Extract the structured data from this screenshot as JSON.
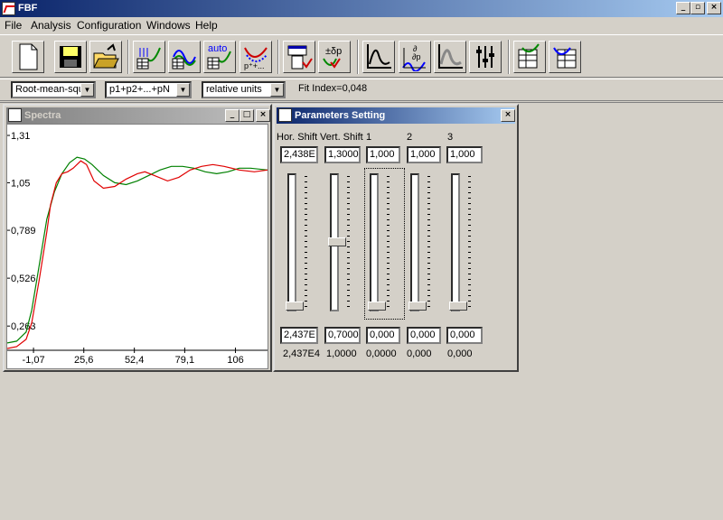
{
  "app": {
    "title": "FBF"
  },
  "menu": [
    "File",
    "Analysis",
    "Configuration",
    "Windows",
    "Help"
  ],
  "toolbar": {
    "icons": [
      "new-document-icon",
      "save-icon",
      "open-folder-icon",
      "table-fit-icon",
      "fit-curve-icon",
      "auto-fit-icon",
      "peak-params-icon",
      "select-sheet-icon",
      "sign-shift-icon",
      "spectrum-icon",
      "derivative-icon",
      "smooth-spectrum-icon",
      "sliders-icon",
      "export-table-icon",
      "import-table-icon"
    ],
    "auto_text": "auto",
    "spd_text": "±δp"
  },
  "options": {
    "metric": "Root-mean-squ",
    "model": "p1+p2+...+pN",
    "units": "relative units",
    "fit_index": "Fit Index=0,048"
  },
  "spectra": {
    "title": "Spectra",
    "chart_data": {
      "type": "line",
      "y_ticks": [
        "1,31",
        "1,05",
        "0,789",
        "0,526",
        "0,263"
      ],
      "x_ticks": [
        "-1,07",
        "25,6",
        "52,4",
        "79,1",
        "106"
      ],
      "xlim": [
        -15,
        123
      ],
      "ylim": [
        0.13,
        1.31
      ],
      "series": [
        {
          "color": "#008000",
          "points": [
            [
              -15,
              0.17
            ],
            [
              -10,
              0.18
            ],
            [
              -5,
              0.23
            ],
            [
              -2,
              0.35
            ],
            [
              2,
              0.6
            ],
            [
              6,
              0.85
            ],
            [
              10,
              1.0
            ],
            [
              14,
              1.1
            ],
            [
              18,
              1.16
            ],
            [
              22,
              1.19
            ],
            [
              26,
              1.18
            ],
            [
              30,
              1.15
            ],
            [
              36,
              1.09
            ],
            [
              42,
              1.05
            ],
            [
              48,
              1.04
            ],
            [
              54,
              1.06
            ],
            [
              60,
              1.09
            ],
            [
              66,
              1.12
            ],
            [
              72,
              1.14
            ],
            [
              78,
              1.14
            ],
            [
              84,
              1.13
            ],
            [
              90,
              1.11
            ],
            [
              96,
              1.1
            ],
            [
              102,
              1.11
            ],
            [
              108,
              1.13
            ],
            [
              114,
              1.13
            ],
            [
              123,
              1.12
            ]
          ]
        },
        {
          "color": "#e00000",
          "points": [
            [
              -15,
              0.14
            ],
            [
              -10,
              0.15
            ],
            [
              -5,
              0.19
            ],
            [
              -2,
              0.28
            ],
            [
              2,
              0.52
            ],
            [
              6,
              0.78
            ],
            [
              8,
              0.93
            ],
            [
              11,
              1.05
            ],
            [
              14,
              1.1
            ],
            [
              17,
              1.11
            ],
            [
              20,
              1.13
            ],
            [
              24,
              1.17
            ],
            [
              27,
              1.15
            ],
            [
              31,
              1.06
            ],
            [
              36,
              1.02
            ],
            [
              42,
              1.03
            ],
            [
              48,
              1.07
            ],
            [
              54,
              1.1
            ],
            [
              58,
              1.11
            ],
            [
              63,
              1.09
            ],
            [
              70,
              1.06
            ],
            [
              76,
              1.08
            ],
            [
              82,
              1.12
            ],
            [
              88,
              1.14
            ],
            [
              94,
              1.15
            ],
            [
              100,
              1.14
            ],
            [
              108,
              1.12
            ],
            [
              116,
              1.11
            ],
            [
              123,
              1.12
            ]
          ]
        }
      ]
    }
  },
  "params": {
    "title": "Parameters Setting",
    "headers": [
      "Hor. Shift",
      "Vert. Shift",
      "1",
      "2",
      "3"
    ],
    "top_values": [
      "2,438E",
      "1,3000",
      "1,000",
      "1,000",
      "1,000"
    ],
    "bottom_values": [
      "2,437E",
      "0,7000",
      "0,000",
      "0,000",
      "0,000"
    ],
    "current_values": [
      "2,437E4",
      "1,0000",
      "0,0000",
      "0,000",
      "0,000"
    ],
    "slider_levels": [
      0.0,
      0.5,
      0.0,
      0.0,
      0.0
    ]
  }
}
